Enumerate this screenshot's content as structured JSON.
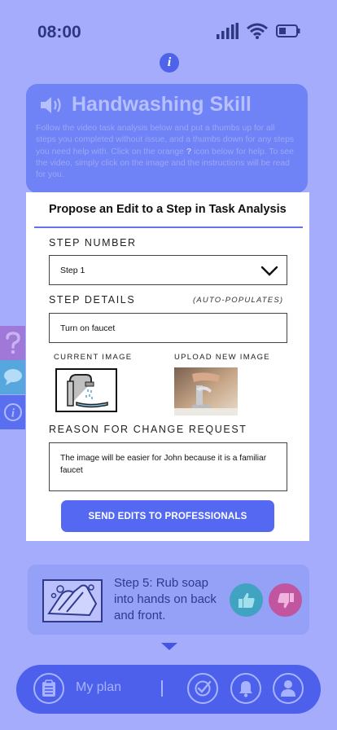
{
  "status_bar": {
    "time": "08:00"
  },
  "hero": {
    "title": "Handwashing Skill",
    "desc_1": "Follow the video task analysis below and put a thumbs up for all steps you completed without issue, and a thumbs down for any steps you need help with. Click on the orange ",
    "desc_q": "?",
    "desc_2": " icon below for help. To see the video, simply click on the image and the instructions will be read for you."
  },
  "modal": {
    "title": "Propose an Edit to a Step in Task Analysis",
    "step_number_label": "STEP NUMBER",
    "step_number_value": "Step 1",
    "step_details_label": "STEP DETAILS",
    "step_details_hint": "(AUTO-POPULATES)",
    "step_details_value": "Turn on faucet",
    "current_image_label": "CURRENT IMAGE",
    "upload_image_label": "UPLOAD NEW IMAGE",
    "reason_label": "REASON FOR CHANGE REQUEST",
    "reason_value": "The image will be easier for John because it is a familiar faucet",
    "send_button": "SEND EDITS TO PROFESSIONALS"
  },
  "side_tabs": [
    "help",
    "chat",
    "info"
  ],
  "step_card": {
    "text": "Step 5: Rub soap into hands on back and front."
  },
  "bottom_nav": {
    "plan_label": "My plan"
  },
  "colors": {
    "background": "#a4acfb",
    "accent": "#5468f2",
    "thumbs_up": "#3fa3c1",
    "thumbs_down": "#c1559f",
    "help_tab": "#9f78d8",
    "chat_tab": "#57a7df",
    "info_tab": "#5a6ff0"
  }
}
